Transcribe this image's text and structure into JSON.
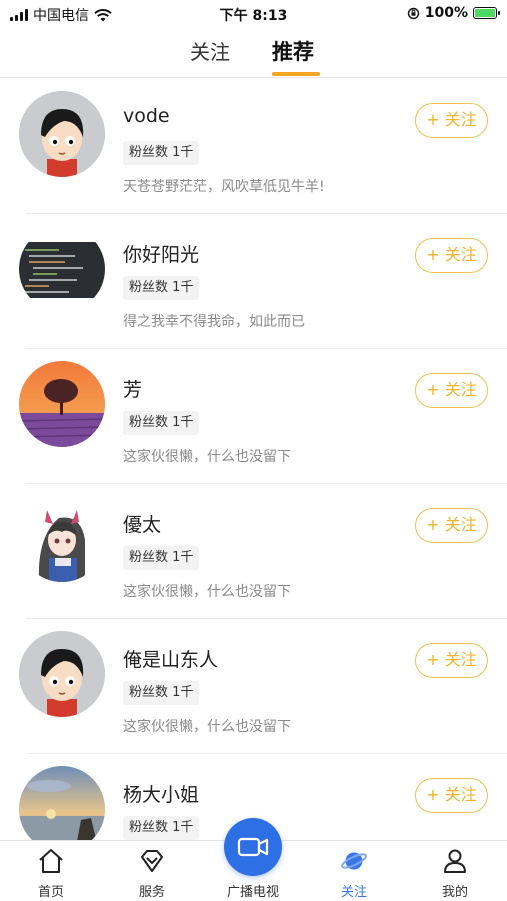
{
  "status_bar": {
    "carrier": "中国电信",
    "time": "下午 8:13",
    "battery": "100%",
    "battery_level": 1.0
  },
  "top_tabs": [
    {
      "label": "关注",
      "active": false
    },
    {
      "label": "推荐",
      "active": true
    }
  ],
  "accent_color": "#f5a623",
  "follow_color": "#f0b429",
  "users": [
    {
      "name": "vode",
      "fans": "粉丝数 1千",
      "bio": "天苍苍野茫茫，风吹草低见牛羊!",
      "follow_label": "+ 关注",
      "avatar_icon": "cartoon-boy-avatar"
    },
    {
      "name": "你好阳光",
      "fans": "粉丝数 1千",
      "bio": "得之我幸不得我命，如此而已",
      "follow_label": "+ 关注",
      "avatar_icon": "code-screen-avatar"
    },
    {
      "name": "芳",
      "fans": "粉丝数 1千",
      "bio": "这家伙很懒，什么也没留下",
      "follow_label": "+ 关注",
      "avatar_icon": "lavender-tree-avatar"
    },
    {
      "name": "優太",
      "fans": "粉丝数 1千",
      "bio": "这家伙很懒，什么也没留下",
      "follow_label": "+ 关注",
      "avatar_icon": "anime-girl-avatar"
    },
    {
      "name": "俺是山东人",
      "fans": "粉丝数 1千",
      "bio": "这家伙很懒，什么也没留下",
      "follow_label": "+ 关注",
      "avatar_icon": "cartoon-boy-avatar"
    },
    {
      "name": "杨大小姐",
      "fans": "粉丝数 1千",
      "bio": "",
      "follow_label": "+ 关注",
      "avatar_icon": "sunset-beach-avatar"
    }
  ],
  "bottom_nav": [
    {
      "label": "首页",
      "icon": "home-icon",
      "active": false
    },
    {
      "label": "服务",
      "icon": "diamond-icon",
      "active": false
    },
    {
      "label": "广播电视",
      "icon": "video-camera-icon",
      "active": false
    },
    {
      "label": "关注",
      "icon": "planet-icon",
      "active": true
    },
    {
      "label": "我的",
      "icon": "user-icon",
      "active": false
    }
  ]
}
